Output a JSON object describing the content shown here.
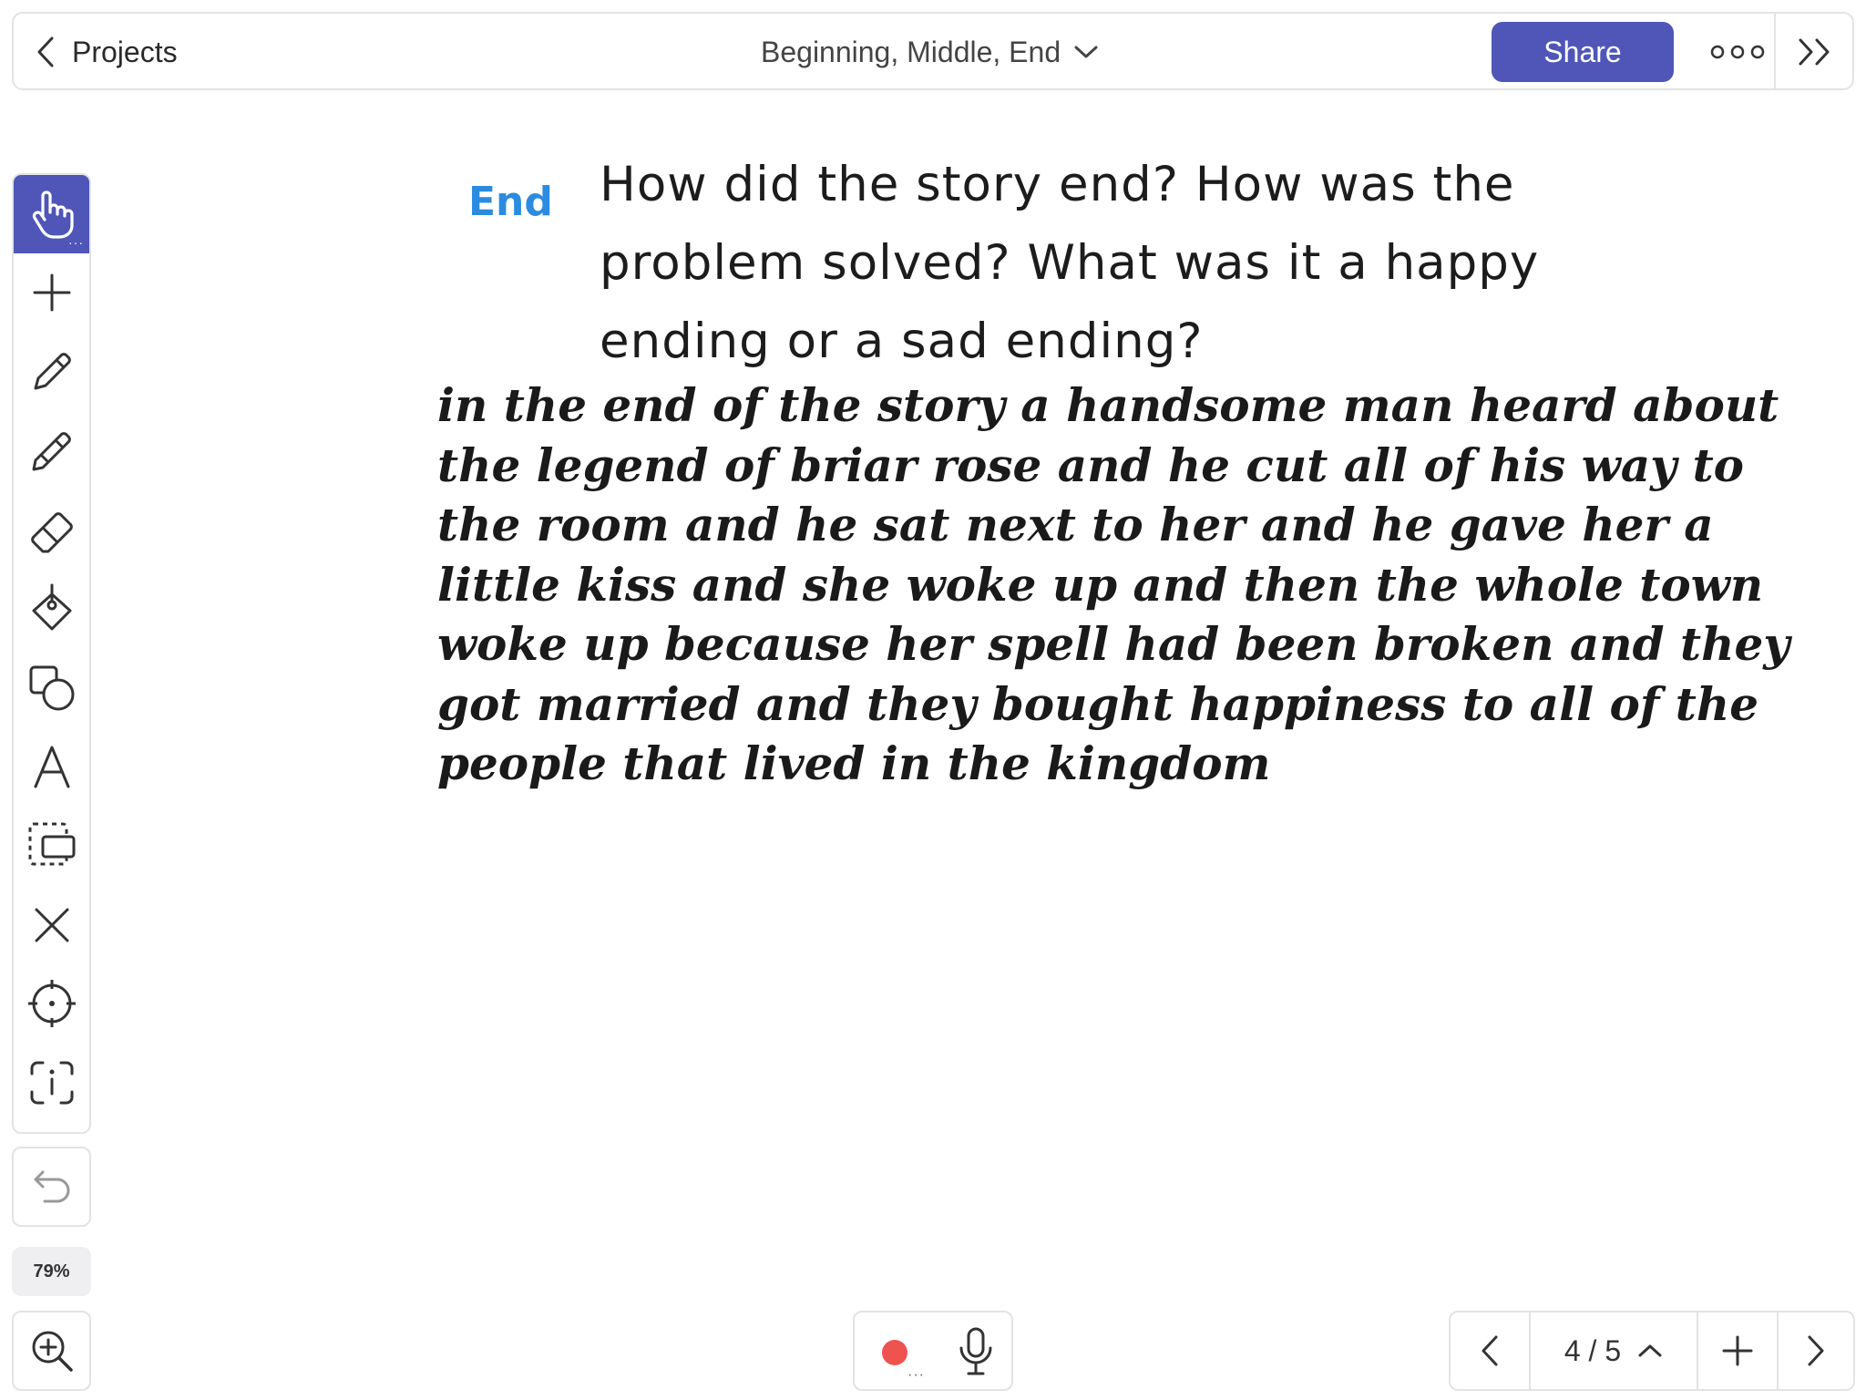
{
  "header": {
    "back_label": "Projects",
    "project_title": "Beginning, Middle, End",
    "share_label": "Share"
  },
  "toolbar": {
    "tools": [
      "hand",
      "add",
      "pen",
      "marker",
      "eraser",
      "fill",
      "shapes",
      "text",
      "select",
      "delete",
      "laser-pointer",
      "info"
    ],
    "active_tool": "hand",
    "zoom_level": "79%"
  },
  "canvas": {
    "section_label": "End",
    "prompt_lines": [
      "How did the story end? How was the",
      "problem solved? What was it a happy",
      "ending or a sad ending?"
    ],
    "response_lines": [
      "in the end of the story a handsome man heard about",
      "the legend of briar rose and he cut all of his way to",
      "the room and he sat next to her and he gave her a",
      "little kiss and she woke up and then the whole town",
      "woke up because her spell had been broken and they",
      "got married and they bought happiness to all of the",
      "people that lived in the kingdom"
    ]
  },
  "recorder": {
    "record_color": "#ef5350"
  },
  "pager": {
    "page_indicator": "4 / 5"
  },
  "colors": {
    "accent": "#4f56b8",
    "section_label": "#2b8be0"
  }
}
